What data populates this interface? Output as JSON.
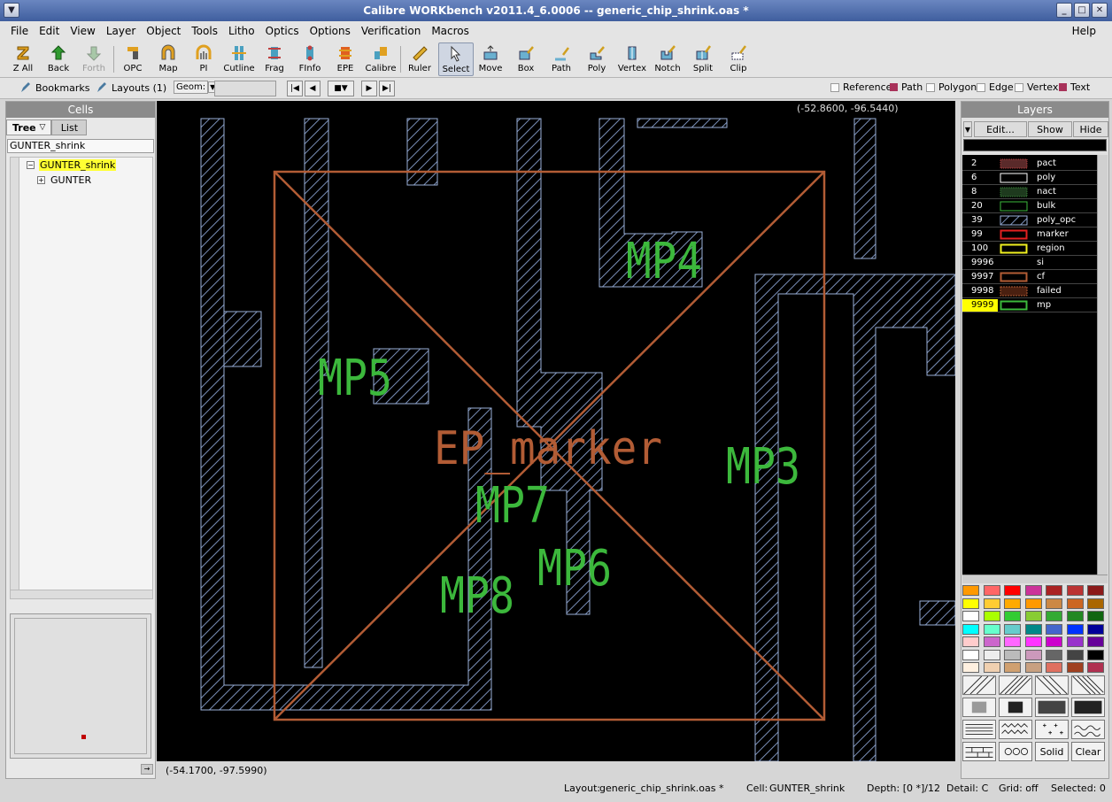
{
  "window": {
    "title": "Calibre WORKbench v2011.4_6.0006  --  generic_chip_shrink.oas *"
  },
  "menu": [
    "File",
    "Edit",
    "View",
    "Layer",
    "Object",
    "Tools",
    "Litho",
    "Optics",
    "Options",
    "Verification",
    "Macros"
  ],
  "menu_help": "Help",
  "toolbar": [
    {
      "label": "Z All",
      "icon": "zoom-all-icon"
    },
    {
      "label": "Back",
      "icon": "back-arrow-icon"
    },
    {
      "label": "Forth",
      "icon": "forth-arrow-icon",
      "disabled": true
    },
    {
      "label": "OPC",
      "icon": "opc-icon"
    },
    {
      "label": "Map",
      "icon": "map-icon"
    },
    {
      "label": "PI",
      "icon": "pi-icon"
    },
    {
      "label": "Cutline",
      "icon": "cutline-icon"
    },
    {
      "label": "Frag",
      "icon": "frag-icon"
    },
    {
      "label": "FInfo",
      "icon": "finfo-icon"
    },
    {
      "label": "EPE",
      "icon": "epe-icon"
    },
    {
      "label": "Calibre",
      "icon": "calibre-icon"
    },
    {
      "label": "Ruler",
      "icon": "ruler-icon"
    },
    {
      "label": "Select",
      "icon": "select-icon",
      "active": true
    },
    {
      "label": "Move",
      "icon": "move-icon"
    },
    {
      "label": "Box",
      "icon": "box-icon"
    },
    {
      "label": "Path",
      "icon": "path-icon"
    },
    {
      "label": "Poly",
      "icon": "poly-icon"
    },
    {
      "label": "Vertex",
      "icon": "vertex-icon"
    },
    {
      "label": "Notch",
      "icon": "notch-icon"
    },
    {
      "label": "Split",
      "icon": "split-icon"
    },
    {
      "label": "Clip",
      "icon": "clip-icon"
    }
  ],
  "row3": {
    "bookmarks": "Bookmarks",
    "layouts": "Layouts (1)",
    "geom": "Geom:",
    "filters": [
      "Reference",
      "Path",
      "Polygon",
      "Edge",
      "Vertex",
      "Text"
    ]
  },
  "cells": {
    "header": "Cells",
    "tabs": [
      "Tree",
      "List"
    ],
    "field": "GUNTER_shrink",
    "tree": [
      {
        "label": "GUNTER_shrink",
        "selected": true
      },
      {
        "label": "GUNTER"
      }
    ]
  },
  "canvas": {
    "coord_top": "(-52.8600, -96.5440)",
    "coord_bottom": "(-54.1700, -97.5990)",
    "texts": [
      "MP4",
      "MP5",
      "MP3",
      "MP7",
      "MP6",
      "MP8",
      "EP_marker"
    ]
  },
  "layers": {
    "header": "Layers",
    "buttons": [
      "Edit...",
      "Show",
      "Hide"
    ],
    "list": [
      {
        "num": "2",
        "name": "pact"
      },
      {
        "num": "6",
        "name": "poly"
      },
      {
        "num": "8",
        "name": "nact"
      },
      {
        "num": "20",
        "name": "bulk"
      },
      {
        "num": "39",
        "name": "poly_opc"
      },
      {
        "num": "99",
        "name": "marker"
      },
      {
        "num": "100",
        "name": "region"
      },
      {
        "num": "9996",
        "name": "si"
      },
      {
        "num": "9997",
        "name": "cf"
      },
      {
        "num": "9998",
        "name": "failed"
      },
      {
        "num": "9999",
        "name": "mp",
        "selected": true
      }
    ],
    "fill_buttons": [
      "Solid",
      "Clear"
    ]
  },
  "status": {
    "layout_label": "Layout:",
    "layout_value": "generic_chip_shrink.oas *",
    "cell_label": "Cell:",
    "cell_value": "GUNTER_shrink",
    "depth": "Depth: [0 *]/12",
    "detail": "Detail:  C",
    "grid": "Grid: off",
    "selected": "Selected:  0"
  }
}
